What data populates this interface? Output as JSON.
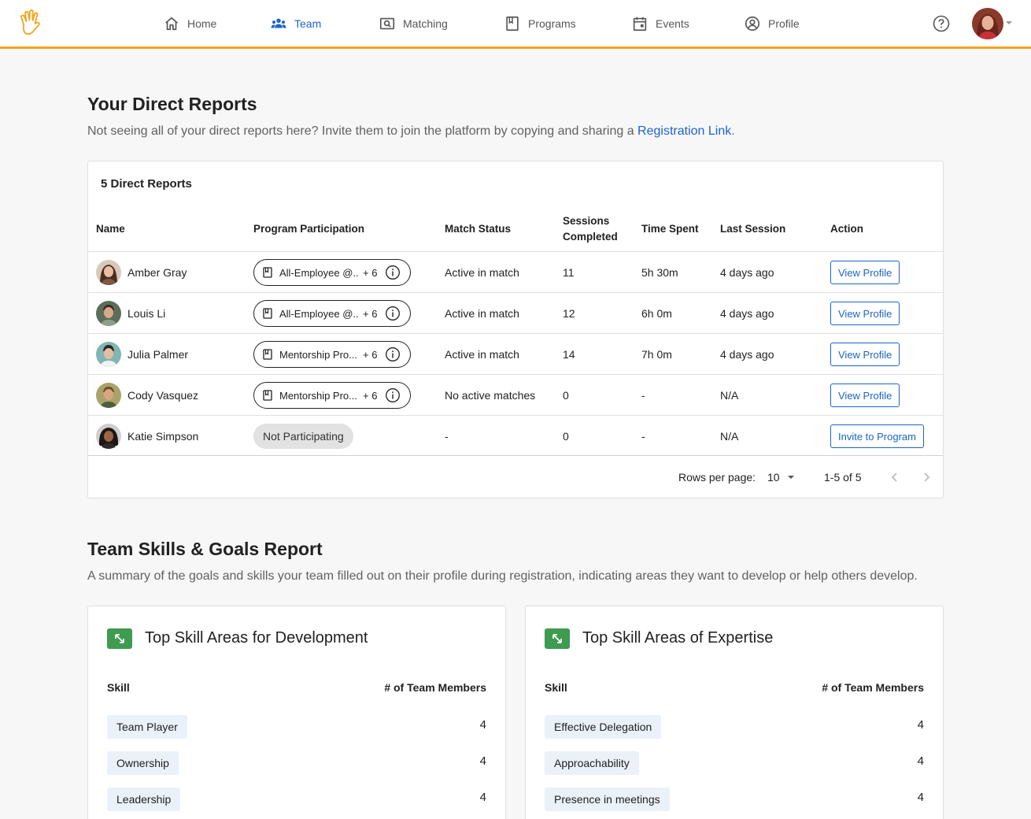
{
  "nav": {
    "items": [
      {
        "label": "Home",
        "icon": "home-icon"
      },
      {
        "label": "Team",
        "icon": "team-icon",
        "active": true
      },
      {
        "label": "Matching",
        "icon": "matching-icon"
      },
      {
        "label": "Programs",
        "icon": "programs-icon"
      },
      {
        "label": "Events",
        "icon": "events-icon"
      },
      {
        "label": "Profile",
        "icon": "profile-icon"
      }
    ],
    "accent_color": "#f7a21b",
    "active_color": "#1e63c8"
  },
  "direct_reports": {
    "title": "Your Direct Reports",
    "subtitle_prefix": "Not seeing all of your direct reports here? Invite them to join the platform by copying and sharing a ",
    "subtitle_link": "Registration Link",
    "subtitle_suffix": ".",
    "card_title": "5 Direct Reports",
    "columns": [
      "Name",
      "Program Participation",
      "Match Status",
      "Sessions Completed",
      "Time Spent",
      "Last Session",
      "Action"
    ],
    "rows": [
      {
        "name": "Amber Gray",
        "program": "All-Employee @...",
        "program_extra": "+ 6",
        "match_status": "Active in match",
        "sessions": "11",
        "time": "5h 30m",
        "last_session": "4 days ago",
        "action": "View Profile"
      },
      {
        "name": "Louis Li",
        "program": "All-Employee @...",
        "program_extra": "+ 6",
        "match_status": "Active in match",
        "sessions": "12",
        "time": "6h 0m",
        "last_session": "4 days ago",
        "action": "View Profile"
      },
      {
        "name": "Julia Palmer",
        "program": "Mentorship Pro...",
        "program_extra": "+ 6",
        "match_status": "Active in match",
        "sessions": "14",
        "time": "7h 0m",
        "last_session": "4 days ago",
        "action": "View Profile"
      },
      {
        "name": "Cody Vasquez",
        "program": "Mentorship Pro...",
        "program_extra": "+ 6",
        "match_status": "No active matches",
        "sessions": "0",
        "time": "-",
        "last_session": "N/A",
        "action": "View Profile"
      },
      {
        "name": "Katie Simpson",
        "program": "Not Participating",
        "program_extra": "",
        "match_status": "-",
        "sessions": "0",
        "time": "-",
        "last_session": "N/A",
        "action": "Invite to Program"
      }
    ],
    "pagination": {
      "rows_per_page_label": "Rows per page:",
      "rows_per_page": "10",
      "range": "1-5 of 5"
    }
  },
  "skills": {
    "title": "Team Skills & Goals Report",
    "subtitle": "A summary of the goals and skills your team filled out on their profile during registration, indicating areas they want to develop or help others develop.",
    "development": {
      "title": "Top Skill Areas for Development",
      "col_skill": "Skill",
      "col_count": "# of Team Members",
      "items": [
        {
          "skill": "Team Player",
          "count": "4"
        },
        {
          "skill": "Ownership",
          "count": "4"
        },
        {
          "skill": "Leadership",
          "count": "4"
        }
      ]
    },
    "expertise": {
      "title": "Top Skill Areas of Expertise",
      "col_skill": "Skill",
      "col_count": "# of Team Members",
      "items": [
        {
          "skill": "Effective Delegation",
          "count": "4"
        },
        {
          "skill": "Approachability",
          "count": "4"
        },
        {
          "skill": "Presence in meetings",
          "count": "4"
        }
      ]
    }
  }
}
